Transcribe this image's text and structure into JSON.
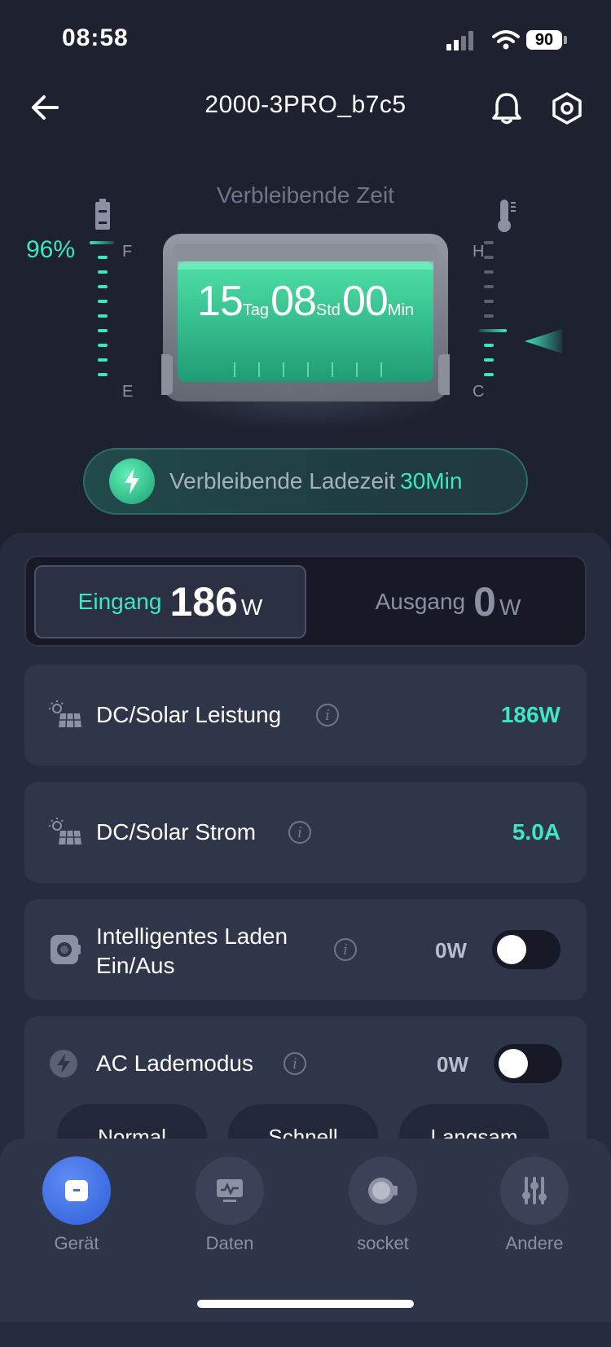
{
  "status": {
    "time": "08:58",
    "battery": "90"
  },
  "header": {
    "title": "2000-3PRO_b7c5"
  },
  "hero": {
    "subtitle": "Verbleibende Zeit",
    "battery_percent": "96%",
    "battery_level": 0.96,
    "left_full": "F",
    "left_empty": "E",
    "right_hot": "H",
    "right_cold": "C",
    "days": "15",
    "days_unit": "Tag",
    "hours": "08",
    "hours_unit": "Std",
    "minutes": "00",
    "minutes_unit": "Min"
  },
  "charge": {
    "label": "Verbleibende Ladezeit",
    "value": "30Min"
  },
  "io": {
    "input_label": "Eingang",
    "input_value": "186",
    "input_unit": "W",
    "output_label": "Ausgang",
    "output_value": "0",
    "output_unit": "W"
  },
  "rows": {
    "dc_power": {
      "label": "DC/Solar Leistung",
      "value": "186W"
    },
    "dc_current": {
      "label": "DC/Solar Strom",
      "value": "5.0A"
    },
    "smart_charge": {
      "label_line1": "Intelligentes Laden",
      "label_line2": "Ein/Aus",
      "value": "0W"
    },
    "ac_mode": {
      "label": "AC Lademodus",
      "value": "0W"
    }
  },
  "modes": [
    "Normal",
    "Schnell",
    "Langsam"
  ],
  "tabs": [
    "Gerät",
    "Daten",
    "socket",
    "Andere"
  ],
  "colors": {
    "accent": "#3ee6c1",
    "background": "#1d2130",
    "card": "#30364a",
    "tab_active": "#3f6ee6"
  }
}
